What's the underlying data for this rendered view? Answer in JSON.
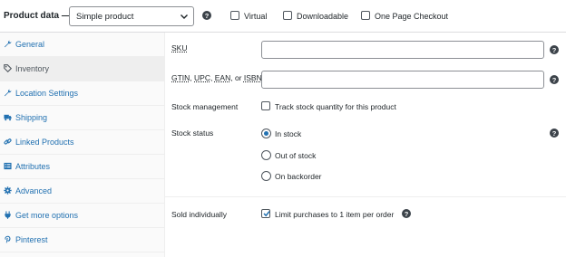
{
  "header": {
    "title": "Product data —",
    "product_type": "Simple product",
    "virtual_label": "Virtual",
    "downloadable_label": "Downloadable",
    "one_page_checkout_label": "One Page Checkout"
  },
  "sidebar": {
    "items": [
      {
        "label": "General",
        "icon": "wrench-icon",
        "active": false
      },
      {
        "label": "Inventory",
        "icon": "tag-icon",
        "active": true
      },
      {
        "label": "Location Settings",
        "icon": "wrench-icon",
        "active": false
      },
      {
        "label": "Shipping",
        "icon": "truck-icon",
        "active": false
      },
      {
        "label": "Linked Products",
        "icon": "link-icon",
        "active": false
      },
      {
        "label": "Attributes",
        "icon": "list-icon",
        "active": false
      },
      {
        "label": "Advanced",
        "icon": "gear-icon",
        "active": false
      },
      {
        "label": "Get more options",
        "icon": "plugin-icon",
        "active": false
      },
      {
        "label": "Pinterest",
        "icon": "pinterest-icon",
        "active": false
      }
    ]
  },
  "inventory": {
    "sku_label": "SKU",
    "sku_value": "",
    "gtin_label_gtin": "GTIN",
    "gtin_label_upc": "UPC",
    "gtin_label_ean": "EAN",
    "gtin_label_or": ", or",
    "gtin_label_isbn": "ISBN",
    "gtin_value": "",
    "stock_management_label": "Stock management",
    "track_stock_label": "Track stock quantity for this product",
    "stock_status_label": "Stock status",
    "stock_options": [
      "In stock",
      "Out of stock",
      "On backorder"
    ],
    "stock_selected": "In stock",
    "sold_individually_label": "Sold individually",
    "limit_purchases_label": "Limit purchases to 1 item per order",
    "limit_purchases_checked": true
  },
  "colors": {
    "accent": "#2271b1",
    "text": "#1d2327",
    "border": "#8c8f94",
    "sidebar_bg": "#fafafa",
    "sidebar_active_bg": "#eeeeee"
  }
}
